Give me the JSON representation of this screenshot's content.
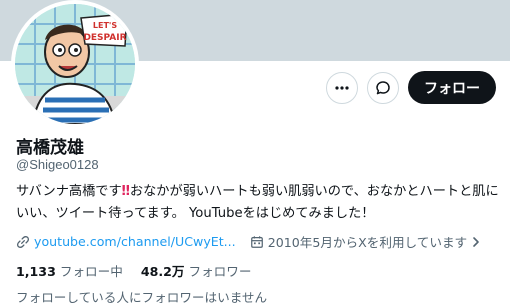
{
  "profile": {
    "display_name": "高橋茂雄",
    "handle": "@Shigeo0128",
    "bio_before": "サバンナ高橋です",
    "bio_emoji": "‼",
    "bio_after": "おなかが弱いハートも弱い肌弱いので、おなかとハートと肌にいい、ツイート待ってます。 YouTubeをはじめてみました！",
    "avatar_text": "LET'S DESPAIR"
  },
  "actions": {
    "more_icon": "more-icon",
    "message_icon": "message-icon",
    "follow_label": "フォロー"
  },
  "meta": {
    "link_text": "youtube.com/channel/UCwyEt...",
    "joined_text": "2010年5月からXを利用しています",
    "link_icon": "link-icon",
    "calendar_icon": "calendar-icon"
  },
  "stats": {
    "following_count": "1,133",
    "following_label": "フォロー中",
    "followers_count": "48.2万",
    "followers_label": "フォロワー"
  },
  "mutuals_note": "フォローしている人にフォロワーはいません",
  "colors": {
    "banner": "#cfd9de",
    "link": "#1d9bf0",
    "button": "#0f1419",
    "secondary_text": "#536471",
    "emoji": "#e0245e"
  }
}
